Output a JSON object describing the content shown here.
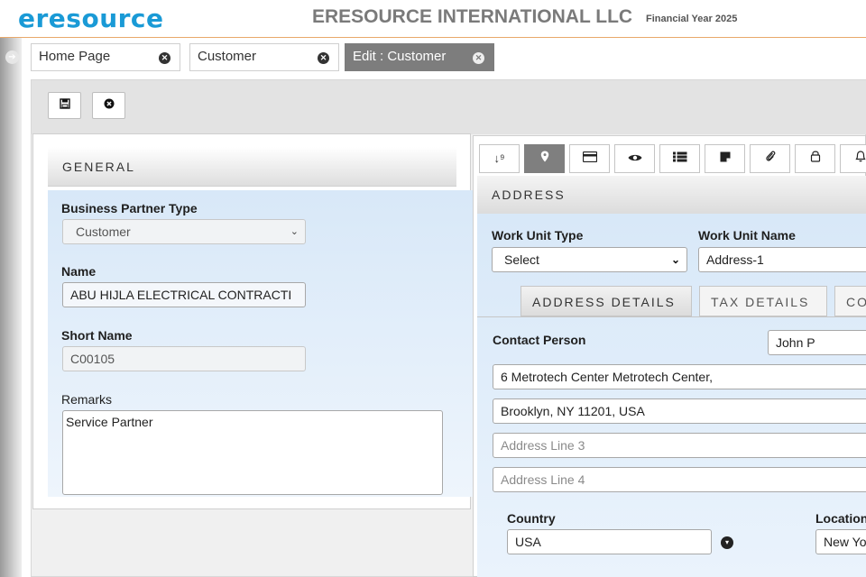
{
  "header": {
    "logo": "eresource",
    "company": "ERESOURCE INTERNATIONAL LLC",
    "financial_year": "Financial Year 2025"
  },
  "tabs": [
    {
      "label": "Home Page"
    },
    {
      "label": "Customer"
    },
    {
      "label": "Edit : Customer"
    }
  ],
  "general": {
    "title": "GENERAL",
    "business_partner_type_label": "Business Partner Type",
    "business_partner_type_value": "Customer",
    "name_label": "Name",
    "name_value": "ABU HIJLA ELECTRICAL CONTRACTI",
    "short_name_label": "Short Name",
    "short_name_value": "C00105",
    "remarks_label": "Remarks",
    "remarks_value": "Service Partner"
  },
  "address": {
    "title": "ADDRESS",
    "icon_tabs": [
      "sort-icon",
      "location-pin-icon",
      "card-icon",
      "eye-icon",
      "list-icon",
      "note-icon",
      "paperclip-icon",
      "lock-icon",
      "bell-icon"
    ],
    "work_unit_type_label": "Work Unit Type",
    "work_unit_type_value": "Select",
    "work_unit_name_label": "Work Unit Name",
    "work_unit_name_value": "Address-1",
    "subtabs": [
      "ADDRESS DETAILS",
      "TAX DETAILS",
      "CO"
    ],
    "contact_person_label": "Contact Person",
    "contact_person_value": "John P",
    "address_line1": "6 Metrotech Center Metrotech Center,",
    "address_line2": "Brooklyn, NY 11201, USA",
    "address_line3_placeholder": "Address Line 3",
    "address_line4_placeholder": "Address Line 4",
    "country_label": "Country",
    "country_value": "USA",
    "location_label": "Location",
    "location_value": "New Yo"
  },
  "colors": {
    "brand": "#1a9ad6",
    "accent_line": "#e8a86a",
    "active_tab": "#7d7d7d"
  }
}
